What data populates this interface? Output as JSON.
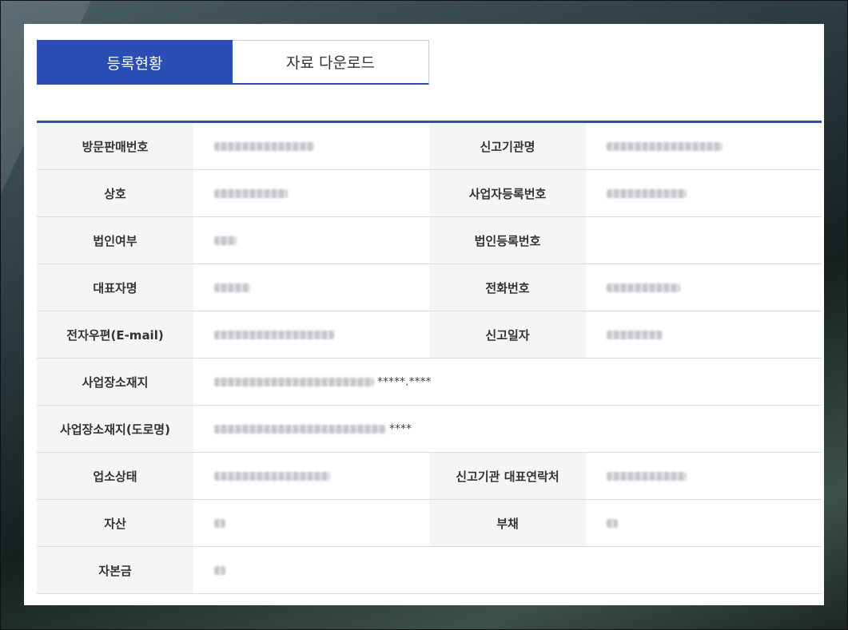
{
  "tabs": [
    {
      "label": "등록현황",
      "active": true
    },
    {
      "label": "자료 다운로드",
      "active": false
    }
  ],
  "rows": [
    {
      "label1": "방문판매번호",
      "label2": "신고기관명",
      "v1_blur": 125,
      "v2_blur": 145
    },
    {
      "label1": "상호",
      "label2": "사업자등록번호",
      "v1_blur": 92,
      "v2_blur": 100
    },
    {
      "label1": "법인여부",
      "label2": "법인등록번호",
      "v1_blur": 28,
      "v2_blur": 0
    },
    {
      "label1": "대표자명",
      "label2": "전화번호",
      "v1_blur": 45,
      "v2_blur": 92
    },
    {
      "label1": "전자우편(E-mail)",
      "label2": "신고일자",
      "v1_blur": 150,
      "v2_blur": 70
    },
    {
      "label1": "사업장소재지",
      "full": true,
      "v1_blur": 200,
      "v1_mask": "*****.****"
    },
    {
      "label1": "사업장소재지(도로명)",
      "full": true,
      "v1_blur": 215,
      "v1_mask": "****"
    },
    {
      "label1": "업소상태",
      "label2": "신고기관 대표연락처",
      "v1_blur": 145,
      "v2_blur": 100
    },
    {
      "label1": "자산",
      "label2": "부채",
      "v1_blur": 14,
      "v2_blur": 14
    },
    {
      "label1": "자본금",
      "full": true,
      "v1_blur": 14
    }
  ],
  "colors": {
    "accent": "#2a4eb5",
    "header_bg": "#f5f5f5",
    "border": "#dcdcdc"
  }
}
